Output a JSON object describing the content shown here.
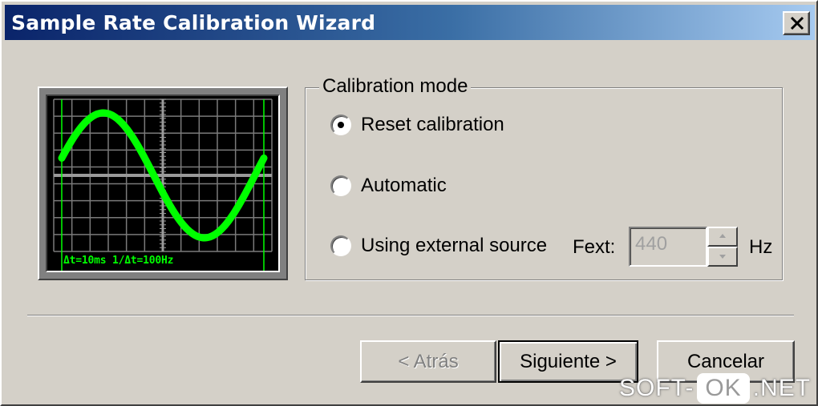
{
  "window": {
    "title": "Sample Rate Calibration Wizard"
  },
  "scope": {
    "caption": "Δt=10ms  1/Δt=100Hz",
    "trace_color": "#00ff00"
  },
  "calibration": {
    "group_label": "Calibration mode",
    "options": [
      {
        "label": "Reset calibration",
        "checked": true
      },
      {
        "label": "Automatic",
        "checked": false
      },
      {
        "label": "Using external source",
        "checked": false
      }
    ],
    "fext_label": "Fext:",
    "fext_value": "440",
    "unit": "Hz"
  },
  "buttons": {
    "back": "< Atrás",
    "next": "Siguiente >",
    "cancel": "Cancelar"
  },
  "watermark": {
    "left": "SOFT-",
    "box": "OK",
    "right": ".NET"
  },
  "colors": {
    "title_start": "#0a246a",
    "title_end": "#a6caf0",
    "face": "#d4d0c8"
  }
}
